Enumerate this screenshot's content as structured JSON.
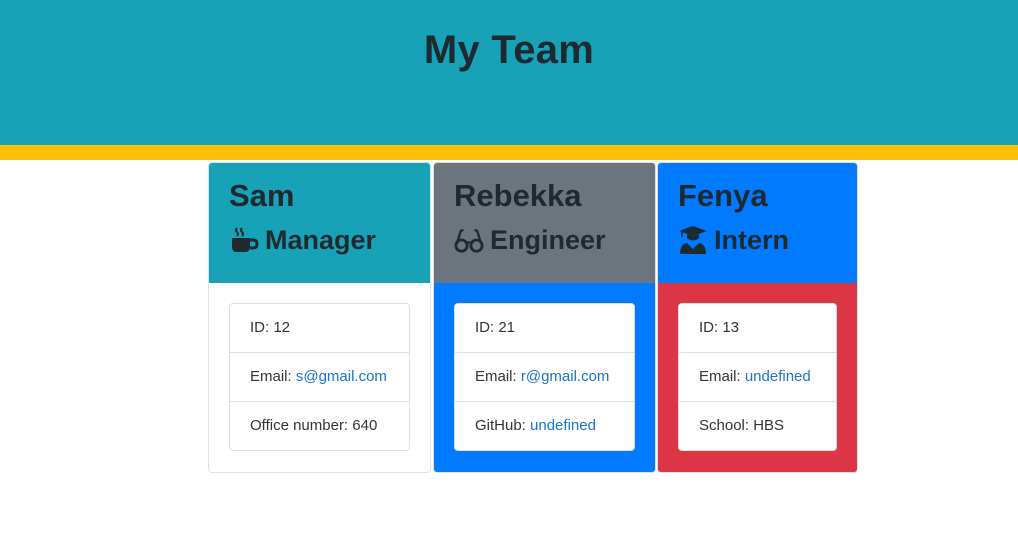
{
  "header": {
    "title": "My Team"
  },
  "colors": {
    "header_bg": "#17a2b8",
    "stripe": "#ffc107",
    "card1_head": "#17a2b8",
    "card1_body": "#ffffff",
    "card2_head": "#6c757d",
    "card2_body": "#007bff",
    "card3_head": "#007bff",
    "card3_body": "#dc3545",
    "link": "#1a73c9"
  },
  "cards": [
    {
      "name": "Sam",
      "role": "Manager",
      "icon": "coffee-mug-icon",
      "id_label": "ID: 12",
      "email_label": "Email: ",
      "email": "s@gmail.com",
      "extra_label": "Office number: 640",
      "extra_link": ""
    },
    {
      "name": "Rebekka",
      "role": "Engineer",
      "icon": "glasses-icon",
      "id_label": "ID: 21",
      "email_label": "Email: ",
      "email": "r@gmail.com",
      "extra_label": "GitHub: ",
      "extra_link": "undefined"
    },
    {
      "name": "Fenya",
      "role": "Intern",
      "icon": "graduate-icon",
      "id_label": "ID: 13",
      "email_label": "Email: ",
      "email": "undefined",
      "extra_label": "School: HBS",
      "extra_link": ""
    }
  ]
}
